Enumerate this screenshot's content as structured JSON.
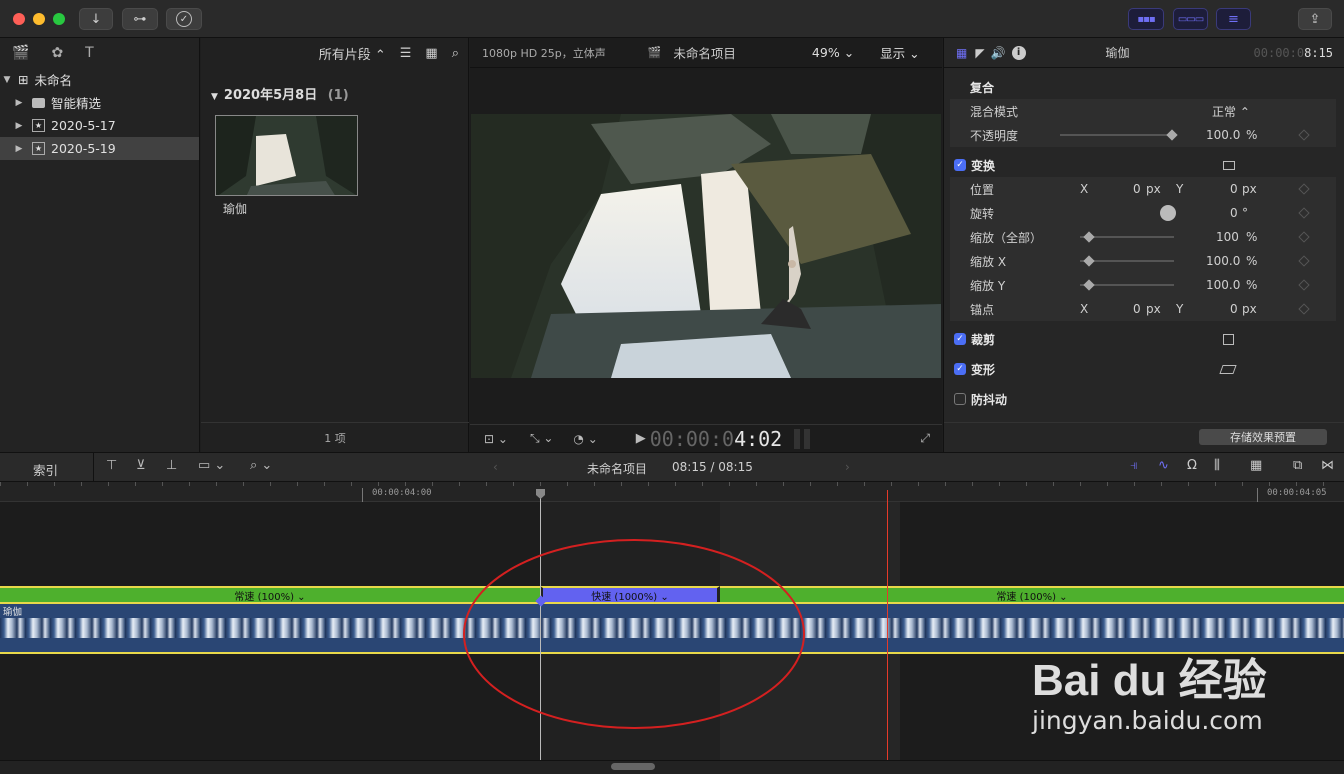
{
  "colors": {
    "accent": "#5b5bf5",
    "speed_normal": "#4eb02d",
    "speed_fast": "#6262f0",
    "playhead": "#e53a2a",
    "clip": "#2a4674",
    "selection": "#e8d84a",
    "annotation": "#d42020"
  },
  "toolbar": {
    "import_icon": "↓",
    "keywords_icon": "⊶",
    "check_icon": "✓",
    "share_icon": "⇪"
  },
  "library": {
    "filter_label": "所有片段 ⌃",
    "rows": [
      {
        "label": "未命名",
        "icon": "⊞",
        "expanded": true
      },
      {
        "label": "智能精选",
        "icon": "▭"
      },
      {
        "label": "2020-5-17",
        "icon": "★"
      },
      {
        "label": "2020-5-19",
        "icon": "★",
        "selected": true
      }
    ]
  },
  "browser": {
    "date_header": "2020年5月8日",
    "count": "(1)",
    "clip_name": "瑜伽",
    "footer": "1 项"
  },
  "viewer": {
    "format": "1080p HD 25p，立体声",
    "project": "未命名项目",
    "zoom": "49%",
    "display": "显示",
    "timecode_dim": "00:00:0",
    "timecode_bright": "4:02"
  },
  "inspector": {
    "clip_name": "瑜伽",
    "timecode_dim": "00:00:0",
    "timecode_bright": "8:15",
    "compound": {
      "title": "复合",
      "blend_label": "混合模式",
      "blend_value": "正常 ⌃",
      "opacity_label": "不透明度",
      "opacity_value": "100.0",
      "opacity_unit": "%"
    },
    "transform": {
      "title": "变换",
      "position_label": "位置",
      "x_label": "X",
      "x_val": "0",
      "y_label": "Y",
      "y_val": "0",
      "px": "px",
      "rotation_label": "旋转",
      "rotation_val": "0",
      "deg": "°",
      "scale_all_label": "缩放（全部）",
      "scale_all_val": "100",
      "scale_x_label": "缩放 X",
      "scale_x_val": "100.0",
      "scale_y_label": "缩放 Y",
      "scale_y_val": "100.0",
      "pct": "%",
      "anchor_label": "锚点",
      "anchor_x": "0",
      "anchor_y": "0"
    },
    "crop_label": "裁剪",
    "distort_label": "变形",
    "stabilize_label": "防抖动",
    "save_preset": "存储效果预置"
  },
  "timeline": {
    "index_label": "索引",
    "project": "未命名项目",
    "duration": "08:15 / 08:15",
    "ruler_left": "00:00:04:00",
    "ruler_right": "00:00:04:05",
    "clip_name": "瑜伽",
    "speed_left": "常速 (100%) ⌄",
    "speed_fast": "快速 (1000%) ⌄",
    "speed_right": "常速 (100%) ⌄"
  },
  "watermark": {
    "brand": "Bai du 经验",
    "url": "jingyan.baidu.com"
  }
}
